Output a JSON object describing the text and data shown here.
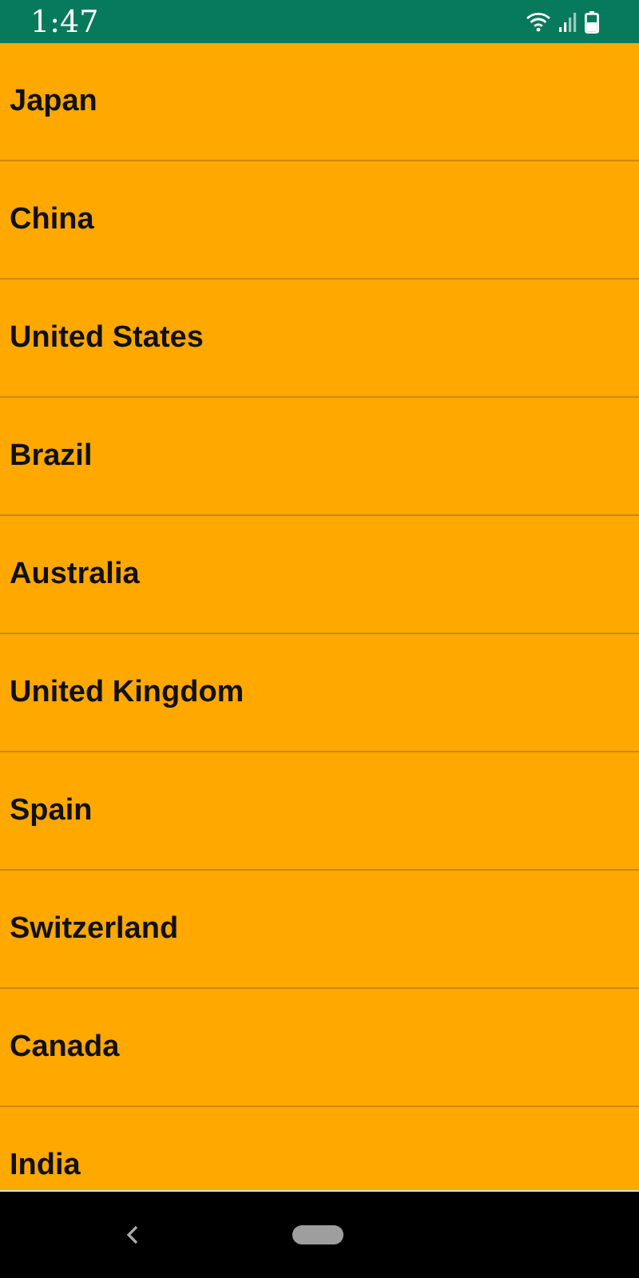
{
  "status_bar": {
    "time": "1:47"
  },
  "countries": [
    "Japan",
    "China",
    "United States",
    "Brazil",
    "Australia",
    "United Kingdom",
    "Spain",
    "Switzerland",
    "Canada",
    "India"
  ]
}
